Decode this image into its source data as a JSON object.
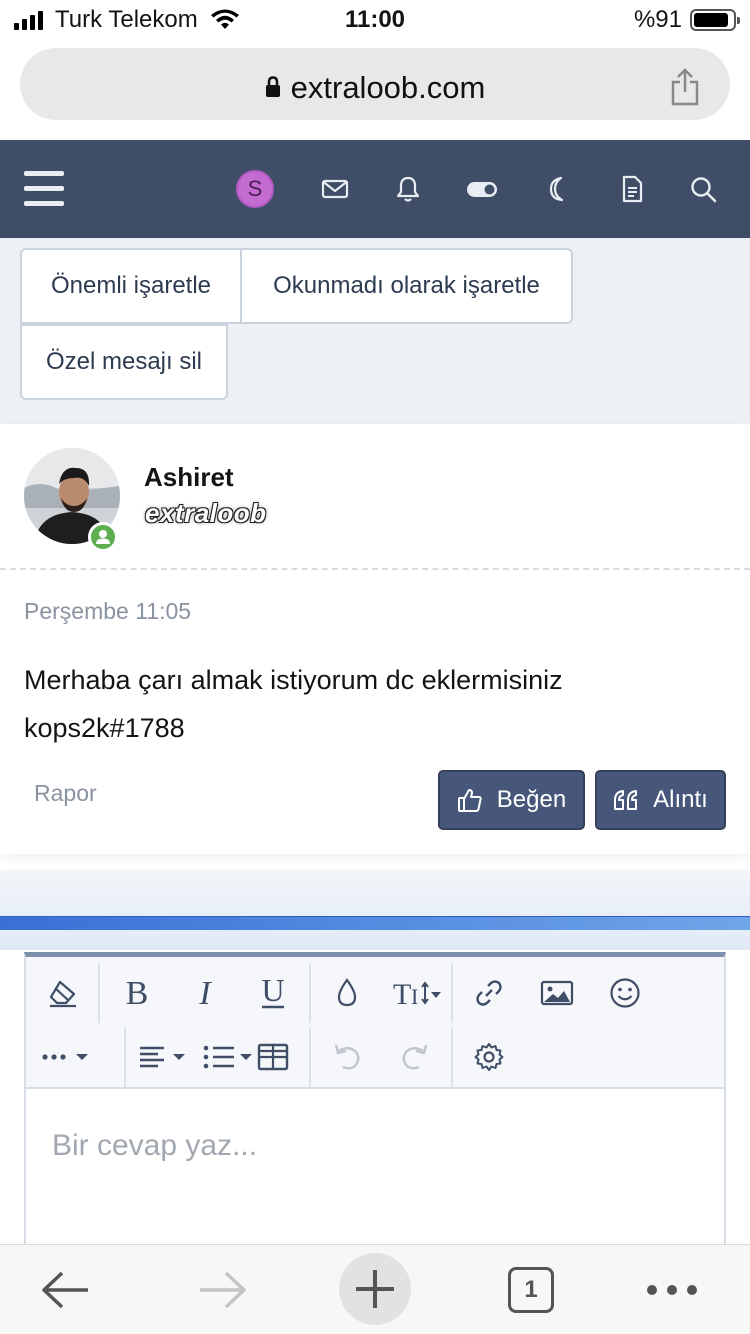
{
  "status": {
    "carrier": "Turk Telekom",
    "time": "11:00",
    "battery": "%91"
  },
  "browser": {
    "url": "extraloob.com",
    "tab_count": "1"
  },
  "header": {
    "user_initial": "S"
  },
  "actions": {
    "mark_important": "Önemli işaretle",
    "mark_unread": "Okunmadı olarak işaretle",
    "delete_message": "Özel mesajı sil"
  },
  "message": {
    "author": "Ashiret",
    "author_title": "extraloob",
    "date": "Perşembe 11:05",
    "body_line1": "Merhaba çarı almak istiyorum dc eklermisiniz",
    "body_line2": "kops2k#1788",
    "report": "Rapor",
    "like": "Beğen",
    "quote": "Alıntı"
  },
  "editor": {
    "placeholder": "Bir cevap yaz..."
  },
  "colors": {
    "header": "#3f4e66",
    "button": "#47577a",
    "online": "#5cae4f",
    "avatar": "#c36bd0"
  }
}
